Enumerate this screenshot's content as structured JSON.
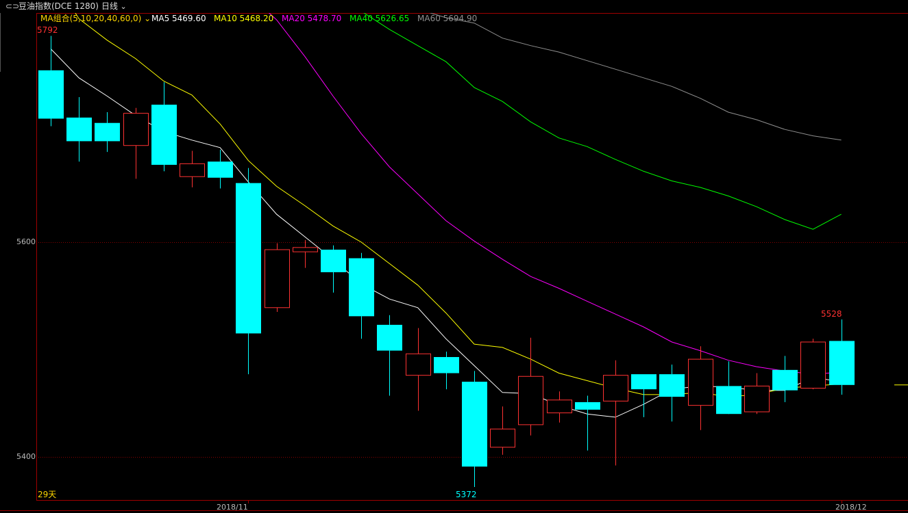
{
  "header": {
    "link_icon": "link-icon",
    "symbol": "豆油指数(DCE 1280)",
    "period": "日线",
    "dropdown_icon": "chevron-down-icon"
  },
  "indicators": {
    "group_label": "MA组合(5,10,20,40,60,0)",
    "ma5": {
      "label": "MA5 5469.60",
      "color": "#ffffff"
    },
    "ma10": {
      "label": "MA10 5468.20",
      "color": "#ffff00"
    },
    "ma20": {
      "label": "MA20 5478.70",
      "color": "#ff00ff"
    },
    "ma40": {
      "label": "MA40 5626.65",
      "color": "#00ff00"
    },
    "ma60": {
      "label": "MA60 5694.90",
      "color": "#909090"
    }
  },
  "annotations": {
    "period_high": "5792",
    "period_low": "5372",
    "last_high": "5528",
    "days": "29天"
  },
  "axes": {
    "y_ticks": [
      "5600",
      "5400"
    ],
    "x_ticks": [
      "2018/11",
      "2018/12"
    ]
  },
  "chart_data": {
    "type": "candlestick",
    "ylim": [
      5360,
      5800
    ],
    "y_tick_values": [
      5600,
      5400
    ],
    "colors": {
      "up": "#ff3232",
      "down": "#00ffff"
    },
    "candles": [
      {
        "o": 5760,
        "c": 5715,
        "h": 5792,
        "l": 5708
      },
      {
        "o": 5716,
        "c": 5694,
        "h": 5735,
        "l": 5675
      },
      {
        "o": 5711,
        "c": 5694,
        "h": 5721,
        "l": 5684
      },
      {
        "o": 5690,
        "c": 5720,
        "h": 5725,
        "l": 5659
      },
      {
        "o": 5728,
        "c": 5672,
        "h": 5749,
        "l": 5666
      },
      {
        "o": 5661,
        "c": 5673,
        "h": 5685,
        "l": 5651
      },
      {
        "o": 5675,
        "c": 5660,
        "h": 5686,
        "l": 5650
      },
      {
        "o": 5655,
        "c": 5515,
        "h": 5669,
        "l": 5477
      },
      {
        "o": 5539,
        "c": 5593,
        "h": 5599,
        "l": 5535
      },
      {
        "o": 5591,
        "c": 5595,
        "h": 5602,
        "l": 5576
      },
      {
        "o": 5593,
        "c": 5572,
        "h": 5597,
        "l": 5553
      },
      {
        "o": 5585,
        "c": 5531,
        "h": 5590,
        "l": 5510
      },
      {
        "o": 5523,
        "c": 5499,
        "h": 5532,
        "l": 5457
      },
      {
        "o": 5476,
        "c": 5496,
        "h": 5520,
        "l": 5443
      },
      {
        "o": 5493,
        "c": 5478,
        "h": 5498,
        "l": 5463
      },
      {
        "o": 5470,
        "c": 5391,
        "h": 5480,
        "l": 5372
      },
      {
        "o": 5409,
        "c": 5426,
        "h": 5447,
        "l": 5402
      },
      {
        "o": 5430,
        "c": 5475,
        "h": 5511,
        "l": 5420
      },
      {
        "o": 5441,
        "c": 5453,
        "h": 5461,
        "l": 5432
      },
      {
        "o": 5451,
        "c": 5444,
        "h": 5457,
        "l": 5406
      },
      {
        "o": 5452,
        "c": 5476,
        "h": 5490,
        "l": 5392
      },
      {
        "o": 5477,
        "c": 5463,
        "h": 5477,
        "l": 5437
      },
      {
        "o": 5477,
        "c": 5456,
        "h": 5486,
        "l": 5433
      },
      {
        "o": 5448,
        "c": 5491,
        "h": 5503,
        "l": 5425
      },
      {
        "o": 5466,
        "c": 5440,
        "h": 5489,
        "l": 5443
      },
      {
        "o": 5442,
        "c": 5466,
        "h": 5478,
        "l": 5440
      },
      {
        "o": 5481,
        "c": 5462,
        "h": 5494,
        "l": 5451
      },
      {
        "o": 5464,
        "c": 5507,
        "h": 5510,
        "l": 5463
      },
      {
        "o": 5508,
        "c": 5467,
        "h": 5528,
        "l": 5458
      }
    ],
    "ma": {
      "ma5": [
        5780,
        5753,
        5736,
        5718,
        5703,
        5695,
        5688,
        5656,
        5626,
        5605,
        5584,
        5561,
        5547,
        5539,
        5510,
        5485,
        5460,
        5459,
        5448,
        5440,
        5437,
        5449,
        5463,
        5466,
        5465,
        5462,
        5462,
        5474,
        5470
      ],
      "ma10": [
        5850,
        5808,
        5788,
        5771,
        5750,
        5737,
        5710,
        5676,
        5652,
        5634,
        5615,
        5600,
        5580,
        5560,
        5534,
        5505,
        5502,
        5491,
        5478,
        5471,
        5464,
        5458,
        5458,
        5460,
        5456,
        5458,
        5464,
        5466,
        5468
      ],
      "ma20": [
        null,
        null,
        null,
        null,
        null,
        null,
        5850,
        5831,
        5807,
        5773,
        5736,
        5701,
        5670,
        5645,
        5620,
        5601,
        5584,
        5568,
        5557,
        5545,
        5533,
        5521,
        5507,
        5499,
        5490,
        5484,
        5480,
        5477,
        5479
      ],
      "ma40": [
        null,
        null,
        null,
        null,
        null,
        null,
        null,
        null,
        5848,
        5837,
        5826,
        5815,
        5798,
        5783,
        5768,
        5744,
        5731,
        5712,
        5697,
        5689,
        5677,
        5666,
        5657,
        5651,
        5643,
        5633,
        5621,
        5612,
        5626
      ],
      "ma60": [
        null,
        null,
        null,
        null,
        null,
        null,
        null,
        null,
        null,
        null,
        null,
        null,
        5830,
        5817,
        5809,
        5804,
        5790,
        5783,
        5777,
        5769,
        5761,
        5753,
        5745,
        5734,
        5721,
        5714,
        5705,
        5699,
        5695
      ]
    },
    "x_ticks": [
      {
        "index": 7,
        "label": "2018/11"
      },
      {
        "index": 28,
        "label": "2018/12"
      }
    ]
  }
}
